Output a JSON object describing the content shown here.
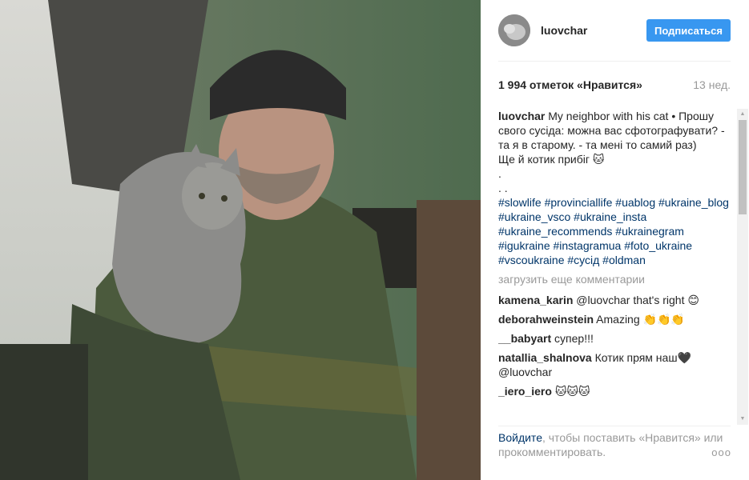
{
  "header": {
    "username": "luovchar",
    "follow_label": "Подписаться"
  },
  "post": {
    "likes": "1 994 отметок «Нравится»",
    "time": "13 нед.",
    "caption_user": "luovchar",
    "caption_text": "My neighbor with his cat • Прошу свого сусіда: можна вас сфотографувати? - та я в старому. - та мені то самий раз)\nЩе й котик прибіг 🐱\n.\n. .",
    "hashtags": "#slowlife #provinciallife #uablog #ukraine_blog #ukraine_vsco #ukraine_insta #ukraine_recommends #ukrainegram #igukraine #instagramua #foto_ukraine #vscoukraine #сусід #oldman"
  },
  "load_more": "загрузить еще комментарии",
  "comments": [
    {
      "user": "kamena_karin",
      "text": "@luovchar that's right 😊"
    },
    {
      "user": "deborahweinstein",
      "text": "Amazing 👏👏👏"
    },
    {
      "user": "__babyart",
      "text": "супер!!!"
    },
    {
      "user": "natallia_shalnova",
      "text": "Котик прям наш🖤 @luovchar"
    },
    {
      "user": "_iero_iero",
      "text": "🐱🐱🐱"
    }
  ],
  "footer": {
    "login": "Войдите",
    "rest": ", чтобы поставить «Нравится» или прокомментировать.",
    "more": "ooo"
  },
  "colors": {
    "accent": "#3897f0",
    "link": "#003569",
    "muted": "#999999"
  }
}
